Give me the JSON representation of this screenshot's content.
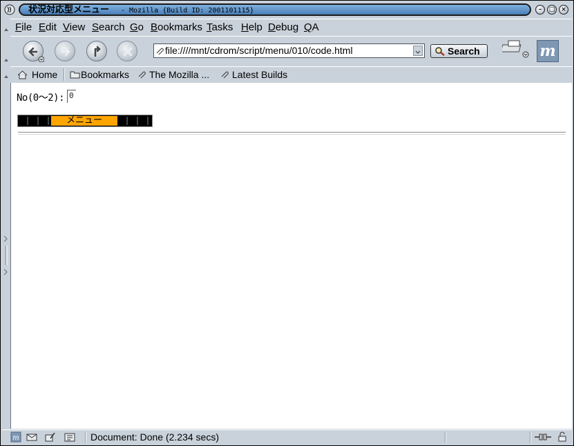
{
  "window": {
    "title_jp": "状況対応型メニュー",
    "title_rest": "- Mozilla {Build ID: 2001101115}"
  },
  "menubar": {
    "items": [
      {
        "key": "F",
        "rest": "ile"
      },
      {
        "key": "E",
        "rest": "dit"
      },
      {
        "key": "V",
        "rest": "iew"
      },
      {
        "key": "S",
        "rest": "earch"
      },
      {
        "key": "G",
        "rest": "o"
      },
      {
        "key": "B",
        "rest": "ookmarks"
      },
      {
        "key": "T",
        "rest": "asks"
      },
      {
        "key": "H",
        "rest": "elp"
      },
      {
        "key": "D",
        "rest": "ebug"
      },
      {
        "key": "Q",
        "rest": "A"
      }
    ]
  },
  "navbar": {
    "url": "file:////mnt/cdrom/script/menu/010/code.html",
    "search_label": "Search"
  },
  "personal_toolbar": {
    "home": "Home",
    "bookmarks": "Bookmarks",
    "mozilla": "The Mozilla ...",
    "latest": "Latest Builds"
  },
  "page": {
    "no_label": "No(0〜2):",
    "no_value": "0",
    "menu_label": "メニュー"
  },
  "status": {
    "text": "Document: Done (2.234 secs)"
  },
  "colors": {
    "chrome": "#c9d2db",
    "title_blue": "#4a7fb8",
    "banner_orange": "#ffa500"
  }
}
